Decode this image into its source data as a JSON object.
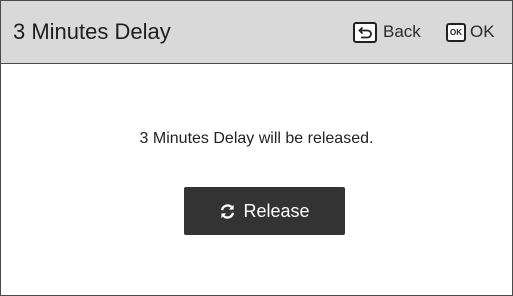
{
  "header": {
    "title": "3 Minutes Delay",
    "back": {
      "icon": "back-return-icon",
      "label": "Back"
    },
    "ok": {
      "icon": "ok-key-icon",
      "icon_text": "OK",
      "label": "OK"
    }
  },
  "main": {
    "message": "3 Minutes Delay will be released.",
    "release_button": {
      "icon": "refresh-icon",
      "label": "Release"
    }
  },
  "colors": {
    "header_bg": "#d9d9d9",
    "button_bg": "#333333",
    "button_text": "#ffffff",
    "border": "#4a4a4a"
  }
}
